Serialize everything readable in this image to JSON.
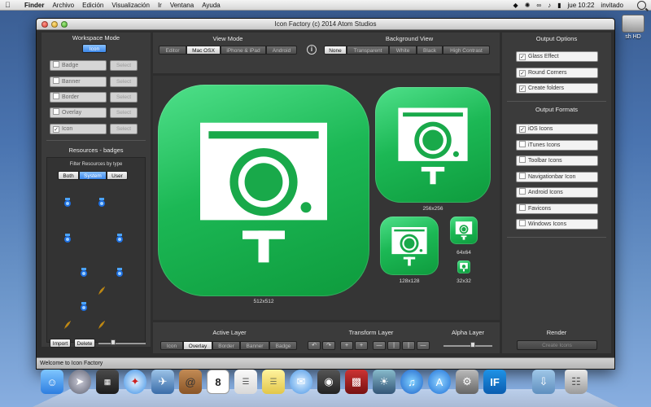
{
  "menubar": {
    "apple": "",
    "app": "Finder",
    "menus": [
      "Archivo",
      "Edición",
      "Visualización",
      "Ir",
      "Ventana",
      "Ayuda"
    ],
    "clock": "jue 10:22",
    "user": "invitado"
  },
  "desktop": {
    "drive_label": "sh HD"
  },
  "window": {
    "title": "Icon Factory (c) 2014 Atom Studios",
    "status": "Welcome to Icon Factory"
  },
  "workspace": {
    "header": "Workspace Mode",
    "mode_button": "Icon",
    "items": [
      {
        "label": "Badge",
        "checked": false,
        "select": "Select"
      },
      {
        "label": "Banner",
        "checked": false,
        "select": "Select"
      },
      {
        "label": "Border",
        "checked": false,
        "select": "Select"
      },
      {
        "label": "Overlay",
        "checked": false,
        "select": "Select"
      },
      {
        "label": "Icon",
        "checked": true,
        "select": "Select"
      }
    ]
  },
  "resources": {
    "header": "Resources - badges",
    "filter_label": "Filter Resources by type",
    "filters": [
      "Both",
      "System",
      "User"
    ],
    "selected_filter": "System",
    "import": "Import",
    "delete": "Delete"
  },
  "view_mode": {
    "header": "View Mode",
    "options": [
      "Editor",
      "Mac OSX",
      "iPhone & iPad",
      "Android"
    ],
    "selected": "Mac OSX",
    "info_icon": "info-icon"
  },
  "background_view": {
    "header": "Background View",
    "options": [
      "None",
      "Transparent",
      "White",
      "Black",
      "High Contrast"
    ],
    "selected": "None"
  },
  "previews": {
    "sizes": [
      "512x512",
      "256x256",
      "128x128",
      "64x64",
      "32x32"
    ]
  },
  "active_layer": {
    "header": "Active Layer",
    "options": [
      "Icon",
      "Overlay",
      "Border",
      "Banner",
      "Badge"
    ],
    "selected": "Overlay"
  },
  "transform_layer": {
    "header": "Transform Layer",
    "buttons": [
      "↶",
      "↷",
      "+",
      "+",
      "—",
      "|",
      "|",
      "—"
    ]
  },
  "alpha_layer": {
    "header": "Alpha Layer",
    "value_percent": 60
  },
  "output_options": {
    "header": "Output Options",
    "items": [
      {
        "label": "Glass Effect",
        "checked": true
      },
      {
        "label": "Round Corners",
        "checked": true
      },
      {
        "label": "Create folders",
        "checked": true
      }
    ]
  },
  "output_formats": {
    "header": "Output Formats",
    "items": [
      {
        "label": "iOS Icons",
        "checked": true
      },
      {
        "label": "iTunes Icons",
        "checked": false
      },
      {
        "label": "Toolbar Icons",
        "checked": false
      },
      {
        "label": "Navigationbar Icon",
        "checked": false
      },
      {
        "label": "Android Icons",
        "checked": false
      },
      {
        "label": "Favicons",
        "checked": false
      },
      {
        "label": "Windows Icons",
        "checked": false
      }
    ]
  },
  "render": {
    "header": "Render",
    "button": "Create Icons"
  },
  "dock": {
    "calendar_day": "8",
    "items": [
      "finder-icon",
      "launchpad-icon",
      "mission-control-icon",
      "safari-icon",
      "mail-icon",
      "contacts-icon",
      "calendar-icon",
      "reminders-icon",
      "notes-icon",
      "messages-icon",
      "facetime-icon",
      "photo-booth-icon",
      "iphoto-icon",
      "itunes-icon",
      "app-store-icon",
      "system-preferences-icon",
      "icon-factory-icon",
      "downloads-icon",
      "trash-icon"
    ]
  },
  "colors": {
    "icon_green": "#1cb855",
    "window_bg": "#2e2e2e",
    "selected_blue": "#3b86e8"
  }
}
